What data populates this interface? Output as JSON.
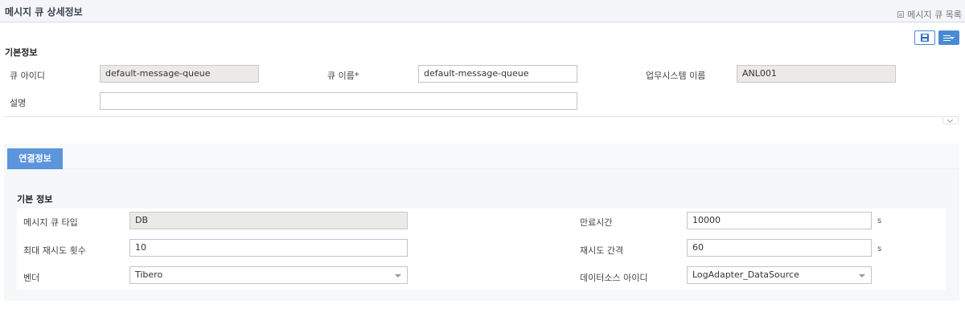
{
  "header": {
    "title": "메시지 큐 상세정보",
    "breadcrumb": "메시지 큐 목록"
  },
  "toolbar": {
    "save_icon": "floppy-disk-icon",
    "menu_icon": "list-menu-icon"
  },
  "basic_info": {
    "section_title": "기본정보",
    "queue_id": {
      "label": "큐 아이디",
      "value": "default-message-queue"
    },
    "queue_name": {
      "label": "큐 이름*",
      "value": "default-message-queue"
    },
    "system_name": {
      "label": "업무시스템 이름",
      "value": "ANL001"
    },
    "description": {
      "label": "설명",
      "value": ""
    }
  },
  "tabs": [
    {
      "label": "연결정보",
      "active": true
    }
  ],
  "connection": {
    "section_title": "기본 정보",
    "queue_type": {
      "label": "메시지 큐 타입",
      "value": "DB"
    },
    "max_retry": {
      "label": "최대 재시도 횟수",
      "value": "10"
    },
    "vendor": {
      "label": "벤더",
      "value": "Tibero"
    },
    "expire_time": {
      "label": "만료시간",
      "value": "10000",
      "unit": "s"
    },
    "retry_interval": {
      "label": "재시도 간격",
      "value": "60",
      "unit": "s"
    },
    "datasource_id": {
      "label": "데이터소스 아이디",
      "value": "LogAdapter_DataSource"
    }
  },
  "colors": {
    "accent": "#5b95dc",
    "readonly_bg": "#ebeae7",
    "header_bg": "#f3f5f8"
  }
}
